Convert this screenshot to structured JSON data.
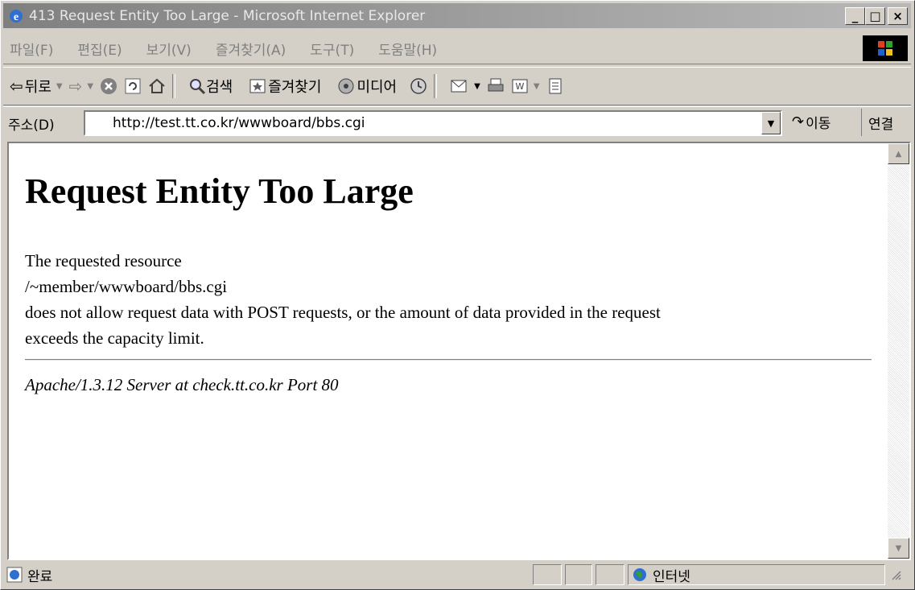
{
  "window": {
    "title": "413 Request Entity Too Large - Microsoft Internet Explorer",
    "controls": [
      "_",
      "□",
      "×"
    ]
  },
  "menu": [
    "파일(F)",
    "편집(E)",
    "보기(V)",
    "즐겨찾기(A)",
    "도구(T)",
    "도움말(H)"
  ],
  "toolbar": {
    "back": "뒤로",
    "search": "검색",
    "favorites": "즐겨찾기",
    "media": "미디어"
  },
  "address": {
    "label": "주소(D)",
    "value": "http://test.tt.co.kr/wwwboard/bbs.cgi",
    "go": "이동",
    "links": "연결"
  },
  "page": {
    "heading": "Request Entity Too Large",
    "line1": "The requested resource",
    "line2": "/~member/wwwboard/bbs.cgi",
    "line3": "does not allow request data with POST requests, or the amount of data provided in the request",
    "line4": "exceeds the capacity limit.",
    "server": "Apache/1.3.12 Server at check.tt.co.kr Port 80"
  },
  "status": {
    "text": "완료",
    "zone": "인터넷"
  }
}
